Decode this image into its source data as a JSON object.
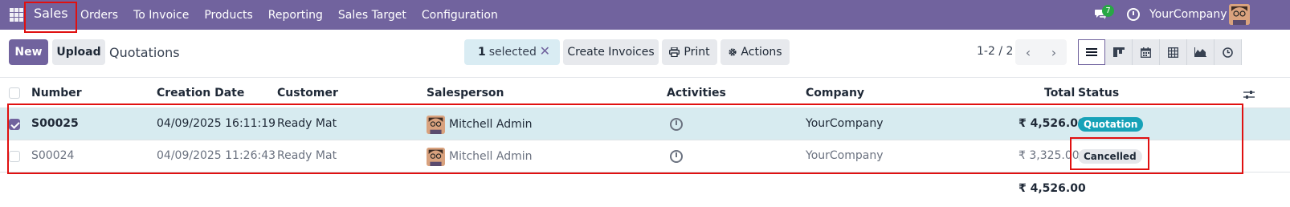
{
  "navbar": {
    "brand": "Sales",
    "menu": [
      "Orders",
      "To Invoice",
      "Products",
      "Reporting",
      "Sales Target",
      "Configuration"
    ],
    "chat_badge_count": "7",
    "company": "YourCompany"
  },
  "control_panel": {
    "new_label": "New",
    "upload_label": "Upload",
    "title": "Quotations",
    "selected_count": "1",
    "selected_label": "selected",
    "clear_selection_glyph": "✕",
    "create_invoices_label": "Create Invoices",
    "print_label": "Print",
    "actions_label": "Actions",
    "pager_value": "1-2 / 2"
  },
  "table": {
    "columns": [
      "Number",
      "Creation Date",
      "Customer",
      "Salesperson",
      "Activities",
      "Company",
      "Total",
      "Status"
    ],
    "rows": [
      {
        "selected": true,
        "number": "S00025",
        "creation_date": "04/09/2025 16:11:19",
        "customer": "Ready Mat",
        "salesperson": "Mitchell Admin",
        "company": "YourCompany",
        "total": "₹ 4,526.00",
        "status": "Quotation"
      },
      {
        "selected": false,
        "number": "S00024",
        "creation_date": "04/09/2025 11:26:43",
        "customer": "Ready Mat",
        "salesperson": "Mitchell Admin",
        "company": "YourCompany",
        "total": "₹ 3,325.00",
        "status": "Cancelled"
      }
    ],
    "footer_total": "₹ 4,526.00"
  },
  "colors": {
    "brand": "#71639e",
    "selected_row": "#d7ebf0",
    "quotation_badge": "#17a2b8",
    "highlight": "#e01010"
  }
}
